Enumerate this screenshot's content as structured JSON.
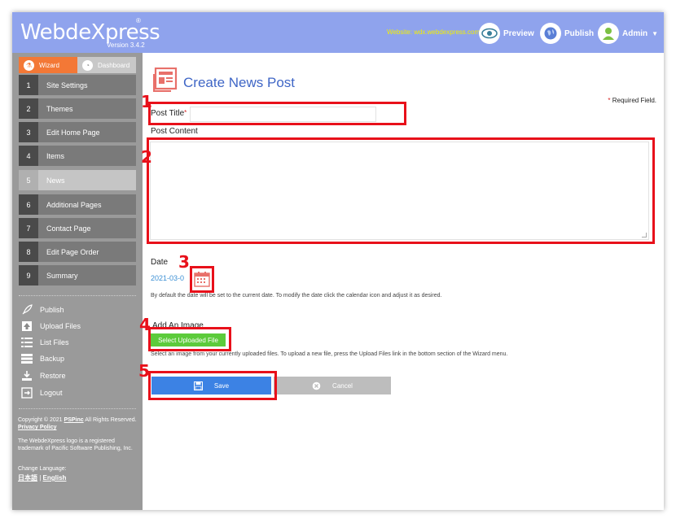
{
  "header": {
    "logo_text": "WebdeXpress",
    "logo_reg": "®",
    "version": "Version 3.4.2",
    "website": "Website: wdx.webdexpress.com",
    "preview_label": "Preview",
    "publish_label": "Publish",
    "admin_label": "Admin",
    "accent": "#8fa3ed"
  },
  "sidebar": {
    "tab_wizard": "Wizard",
    "tab_dashboard": "Dashboard",
    "steps": [
      {
        "num": "1",
        "label": "Site Settings"
      },
      {
        "num": "2",
        "label": "Themes"
      },
      {
        "num": "3",
        "label": "Edit Home Page"
      },
      {
        "num": "4",
        "label": "Items"
      },
      {
        "num": "5",
        "label": "News"
      },
      {
        "num": "6",
        "label": "Additional Pages"
      },
      {
        "num": "7",
        "label": "Contact Page"
      },
      {
        "num": "8",
        "label": "Edit Page Order"
      },
      {
        "num": "9",
        "label": "Summary"
      }
    ],
    "active_step": "5",
    "tools": [
      {
        "label": "Publish",
        "icon": "rocket-icon"
      },
      {
        "label": "Upload Files",
        "icon": "upload-icon"
      },
      {
        "label": "List Files",
        "icon": "list-icon"
      },
      {
        "label": "Backup",
        "icon": "backup-icon"
      },
      {
        "label": "Restore",
        "icon": "restore-icon"
      },
      {
        "label": "Logout",
        "icon": "logout-icon"
      }
    ],
    "copyright_prefix": "Copyright © 2021",
    "company_link": "PSPinc",
    "copyright_suffix": "All Rights Reserved.",
    "privacy_link": "Privacy Policy",
    "trademark": "The WebdeXpress logo is a registered trademark of Pacific Software Publishing, Inc.",
    "change_language": "Change Language:",
    "lang_ja": "日本語",
    "lang_sep": "|",
    "lang_en": "English"
  },
  "main": {
    "title": "Create News Post",
    "required_star": "*",
    "required_text": "Required Field.",
    "post_title_label": "Post Title",
    "post_title_star": "*",
    "post_title_value": "",
    "post_content_label": "Post Content",
    "post_content_value": "",
    "date_label": "Date",
    "date_value": "2021-03-0",
    "date_help": "By default the date will be set to the current date. To modify the date click the calendar icon and adjust it as desired.",
    "image_label": "Add An Image",
    "select_file_label": "Select Uploaded File",
    "image_help": "Select an image from your currently uploaded files. To upload a new file, press the Upload Files link in the bottom section of the Wizard menu.",
    "save_label": "Save",
    "cancel_label": "Cancel"
  },
  "annotations": [
    "1",
    "2",
    "3",
    "4",
    "5"
  ],
  "colors": {
    "annotation_red": "#e8101a",
    "title_blue": "#3f66c6",
    "wizard_orange": "#f37836",
    "save_blue": "#3c82e4",
    "select_green": "#5ccb3b"
  }
}
